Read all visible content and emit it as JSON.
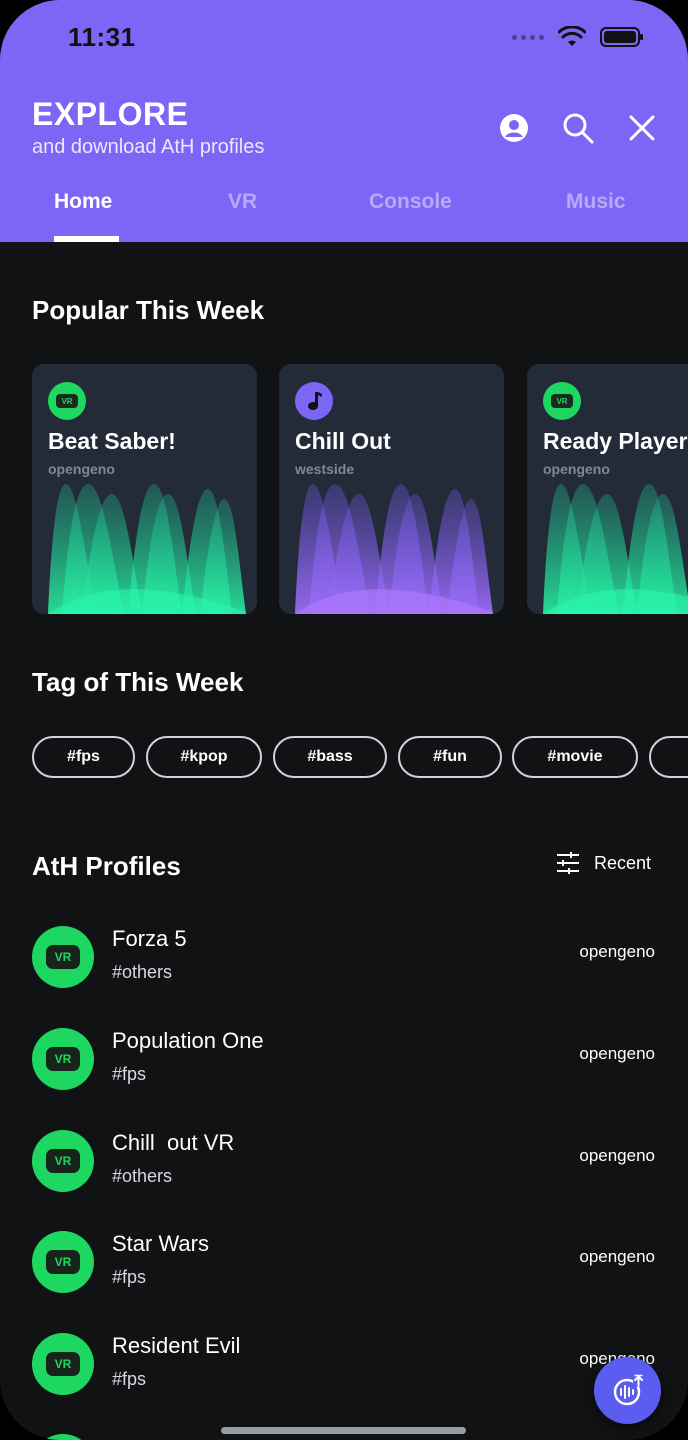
{
  "status_bar": {
    "time": "11:31"
  },
  "header": {
    "title": "EXPLORE",
    "subtitle": "and download AtH profiles",
    "icons": [
      "account-icon",
      "search-icon",
      "close-icon"
    ],
    "tabs": [
      {
        "label": "Home",
        "active": true
      },
      {
        "label": "VR",
        "active": false
      },
      {
        "label": "Console",
        "active": false
      },
      {
        "label": "Music",
        "active": false
      }
    ]
  },
  "popular": {
    "title": "Popular This Week",
    "cards": [
      {
        "title": "Beat Saber!",
        "author": "opengeno",
        "badge": "VR",
        "theme": "green"
      },
      {
        "title": "Chill Out",
        "author": "westside",
        "badge": "music-note-icon",
        "theme": "purple"
      },
      {
        "title": "Ready Player",
        "author": "opengeno",
        "badge": "VR",
        "theme": "green"
      }
    ]
  },
  "tags": {
    "title": "Tag of This Week",
    "items": [
      "#fps",
      "#kpop",
      "#bass",
      "#fun",
      "#movie"
    ]
  },
  "profiles": {
    "title": "AtH Profiles",
    "sort_label": "Recent",
    "items": [
      {
        "title": "Forza 5",
        "tag": "#others",
        "author": "opengeno",
        "badge": "VR"
      },
      {
        "title": "Population One",
        "tag": "#fps",
        "author": "opengeno",
        "badge": "VR"
      },
      {
        "title": "Chill  out VR",
        "tag": "#others",
        "author": "opengeno",
        "badge": "VR"
      },
      {
        "title": "Star Wars",
        "tag": "#fps",
        "author": "opengeno",
        "badge": "VR"
      },
      {
        "title": "Resident Evil",
        "tag": "#fps",
        "author": "opengeno",
        "badge": "VR"
      }
    ]
  },
  "colors": {
    "header_bg": "#7B66F5",
    "page_bg": "#111214",
    "card_bg": "#232a38",
    "vr_green": "#1ED760",
    "fab": "#5B5CF0"
  }
}
